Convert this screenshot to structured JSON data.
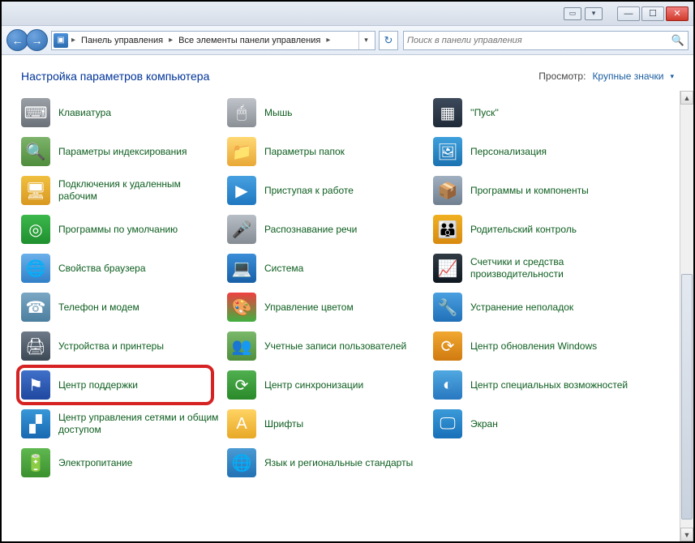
{
  "titlebar": {
    "extra_button_glyph": "▭",
    "dropdown_glyph": "▾",
    "minimize": "—",
    "maximize": "☐",
    "close": "✕"
  },
  "nav": {
    "back_glyph": "←",
    "fwd_glyph": "→"
  },
  "breadcrumb": {
    "icon": "▣",
    "seg1": "Панель управления",
    "seg2": "Все элементы панели управления",
    "sep": "▸",
    "drop": "▾",
    "refresh": "↻"
  },
  "search": {
    "placeholder": "Поиск в панели управления",
    "icon": "🔍"
  },
  "header": {
    "title": "Настройка параметров компьютера",
    "view_label": "Просмотр:",
    "view_value": "Крупные значки",
    "chev": "▾"
  },
  "items": {
    "c0": [
      {
        "icon": "⌨",
        "cls": "ic-kbd",
        "label": "Клавиатура"
      },
      {
        "icon": "🔍",
        "cls": "ic-index",
        "label": "Параметры индексирования"
      },
      {
        "icon": "🖥",
        "cls": "ic-rdp",
        "label": "Подключения к удаленным рабочим"
      },
      {
        "icon": "◎",
        "cls": "ic-defprog",
        "label": "Программы по умолчанию"
      },
      {
        "icon": "🌐",
        "cls": "ic-browser",
        "label": "Свойства браузера"
      },
      {
        "icon": "☎",
        "cls": "ic-phone",
        "label": "Телефон и модем"
      },
      {
        "icon": "🖨",
        "cls": "ic-devprint",
        "label": "Устройства и принтеры"
      },
      {
        "icon": "⚑",
        "cls": "ic-flag",
        "label": "Центр поддержки",
        "highlight": true
      },
      {
        "icon": "▞",
        "cls": "ic-network",
        "label": "Центр управления сетями и общим доступом"
      },
      {
        "icon": "🔋",
        "cls": "ic-power",
        "label": "Электропитание"
      }
    ],
    "c1": [
      {
        "icon": "🖱",
        "cls": "ic-mouse",
        "label": "Мышь"
      },
      {
        "icon": "📁",
        "cls": "ic-folder",
        "label": "Параметры папок"
      },
      {
        "icon": "▶",
        "cls": "ic-getstart",
        "label": "Приступая к работе"
      },
      {
        "icon": "🎤",
        "cls": "ic-mic",
        "label": "Распознавание речи"
      },
      {
        "icon": "💻",
        "cls": "ic-system",
        "label": "Система"
      },
      {
        "icon": "🎨",
        "cls": "ic-color",
        "label": "Управление цветом"
      },
      {
        "icon": "👥",
        "cls": "ic-users",
        "label": "Учетные записи пользователей"
      },
      {
        "icon": "⟳",
        "cls": "ic-sync",
        "label": "Центр синхронизации"
      },
      {
        "icon": "A",
        "cls": "ic-font",
        "label": "Шрифты"
      },
      {
        "icon": "🌐",
        "cls": "ic-lang",
        "label": "Язык и региональные стандарты"
      }
    ],
    "c2": [
      {
        "icon": "▦",
        "cls": "ic-start",
        "label": "''Пуск''"
      },
      {
        "icon": "🖼",
        "cls": "ic-person",
        "label": "Персонализация"
      },
      {
        "icon": "📦",
        "cls": "ic-prog",
        "label": "Программы и компоненты"
      },
      {
        "icon": "👪",
        "cls": "ic-parent",
        "label": "Родительский контроль"
      },
      {
        "icon": "📈",
        "cls": "ic-perf",
        "label": "Счетчики и средства производительности"
      },
      {
        "icon": "🔧",
        "cls": "ic-trouble",
        "label": "Устранение неполадок"
      },
      {
        "icon": "⟳",
        "cls": "ic-winupd",
        "label": "Центр обновления Windows"
      },
      {
        "icon": "◐",
        "cls": "ic-access",
        "label": "Центр специальных возможностей"
      },
      {
        "icon": "🖵",
        "cls": "ic-screen",
        "label": "Экран"
      }
    ]
  },
  "scrollbar": {
    "up": "▲",
    "down": "▼"
  }
}
